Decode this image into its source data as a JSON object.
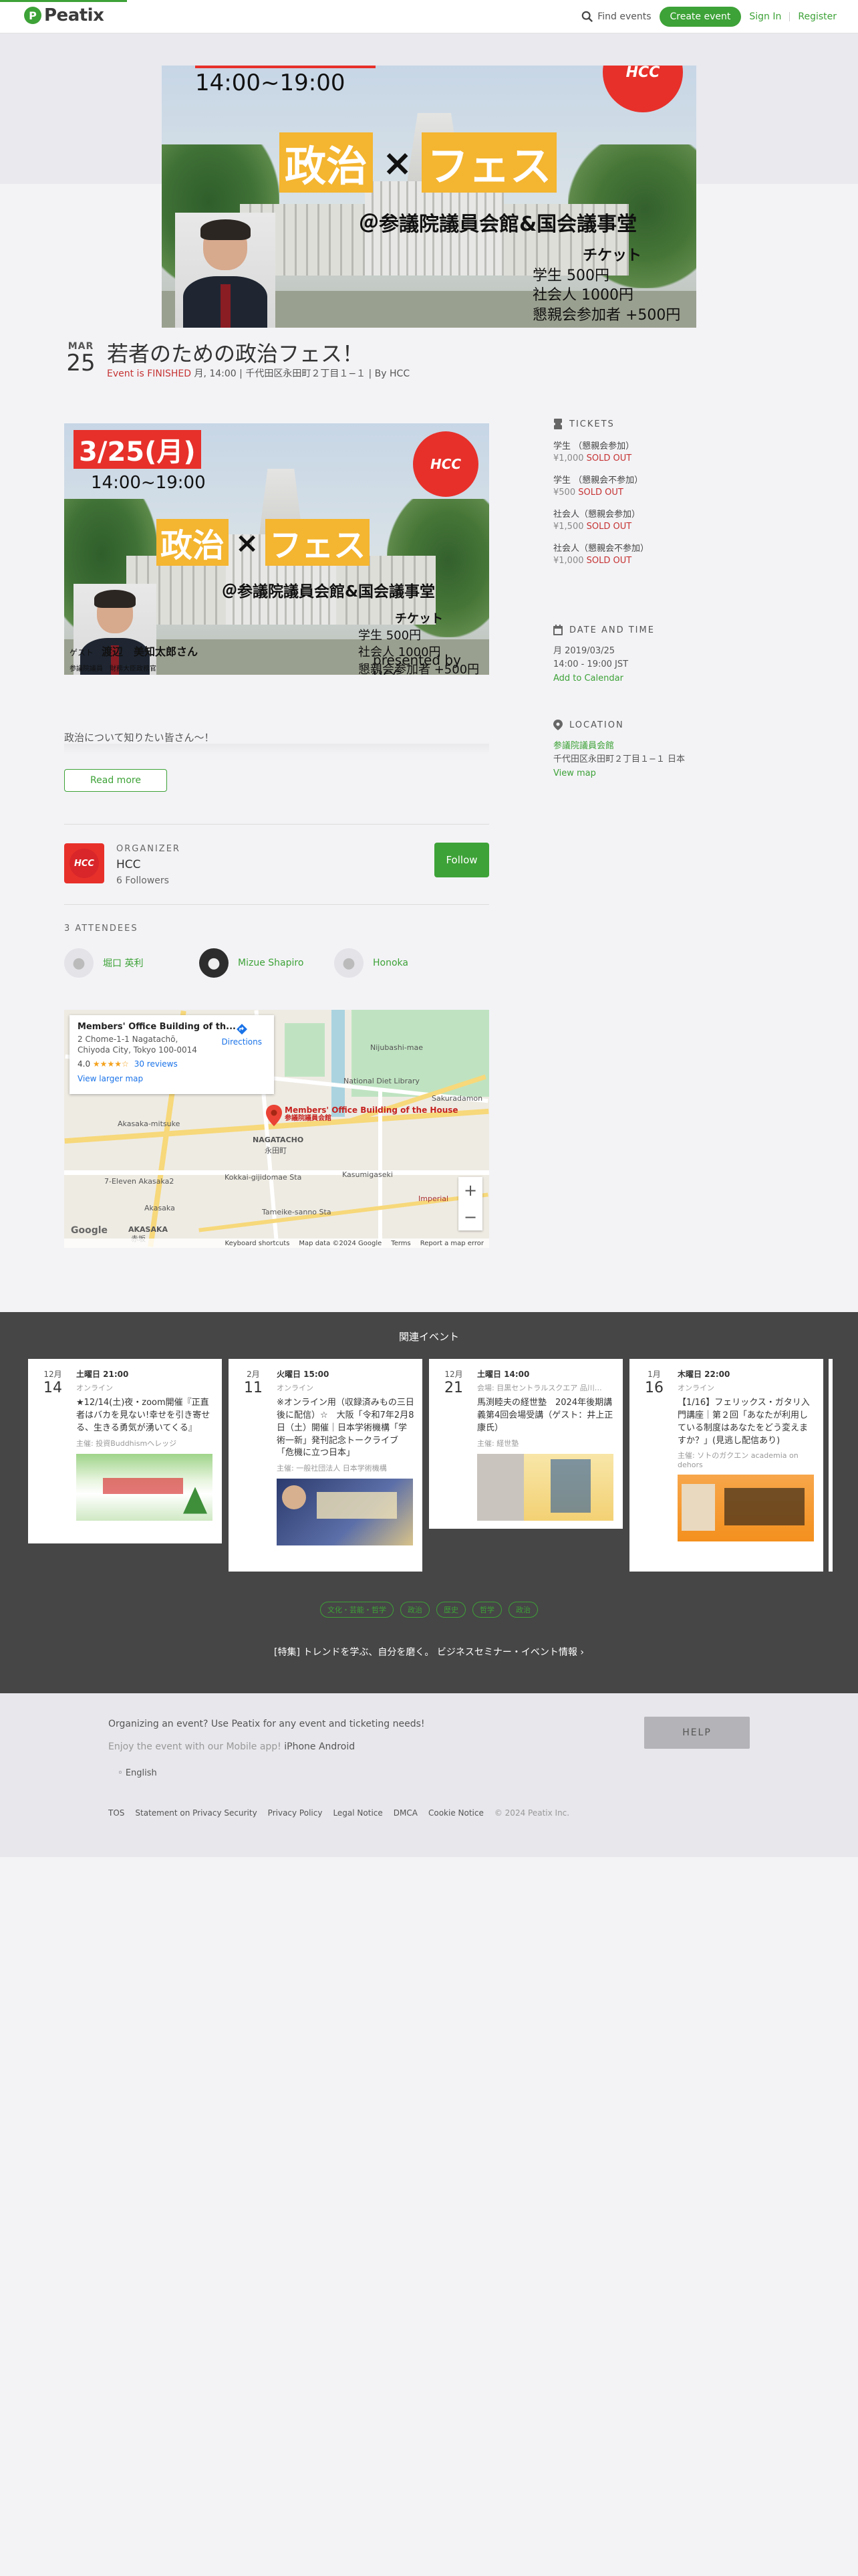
{
  "header": {
    "logo_text": "Peatix",
    "find_events": "Find events",
    "create_event": "Create event",
    "sign_in": "Sign In",
    "register": "Register"
  },
  "poster": {
    "date": "3/25(月)",
    "time": "14:00~19:00",
    "fes_left": "政治",
    "fes_x": "×",
    "fes_right": "フェス",
    "venue": "＠参議院議員会館&国会議事堂",
    "ticket_title": "チケット",
    "ticket_lines": [
      "学生 500円",
      "社会人 1000円",
      "懇親会参加者 +500円"
    ],
    "hcc_logo": "HCC",
    "guest_label": "ゲスト",
    "guest_name": "渡辺　美知太郎さん",
    "guest_title": "参議院議員　財務大臣政務官",
    "presented_by": "presented by HCC"
  },
  "event": {
    "month": "MAR",
    "day": "25",
    "title": "若者のための政治フェス！",
    "status": "Event is FINISHED",
    "meta": "月, 14:00 | 千代田区永田町２丁目１−１ | By HCC",
    "description": "政治について知りたい皆さん～！",
    "read_more": "Read more"
  },
  "organizer": {
    "label": "ORGANIZER",
    "name": "HCC",
    "followers": "6 Followers",
    "follow_button": "Follow",
    "avatar_text": "HCC"
  },
  "attendees": {
    "label": "3 ATTENDEES",
    "list": [
      {
        "name": "堀口 英利"
      },
      {
        "name": "Mizue Shapiro"
      },
      {
        "name": "Honoka"
      }
    ]
  },
  "map": {
    "place_name": "Members' Office Building of th...",
    "address": "2 Chome-1-1 Nagatachō, Chiyoda City, Tokyo 100-0014",
    "rating": "4.0",
    "stars": "★★★★☆",
    "reviews": "30 reviews",
    "directions": "Directions",
    "larger_map": "View larger map",
    "pin_label_en": "Members' Office Building of the House",
    "pin_label_jp": "参議院議員会館",
    "labels": [
      "National Diet Library",
      "Nijubashi-mae",
      "Sakuradamon",
      "Akasaka-mitsuke",
      "NAGATACHO",
      "永田町",
      "Kokkai-gijidomae Sta",
      "Kasumigaseki",
      "Tameike-sanno Sta",
      "7-Eleven Akasaka2",
      "Akasaka",
      "AKASAKA",
      "赤坂",
      "Imperial"
    ],
    "keyboard": "Keyboard shortcuts",
    "map_data": "Map data ©2024 Google",
    "terms": "Terms",
    "report": "Report a map error",
    "google": "Google"
  },
  "sidebar": {
    "tickets_label": "TICKETS",
    "tickets": [
      {
        "name": "学生 （懇親会参加）",
        "price": "¥1,000",
        "status": "SOLD OUT"
      },
      {
        "name": "学生 （懇親会不参加）",
        "price": "¥500",
        "status": "SOLD OUT"
      },
      {
        "name": "社会人（懇親会参加）",
        "price": "¥1,500",
        "status": "SOLD OUT"
      },
      {
        "name": "社会人（懇親会不参加）",
        "price": "¥1,000",
        "status": "SOLD OUT"
      }
    ],
    "datetime_label": "DATE AND TIME",
    "date_line": "月 2019/03/25",
    "time_line": "14:00 - 19:00 JST",
    "add_calendar": "Add to Calendar",
    "location_label": "LOCATION",
    "location_name": "参議院議員会館",
    "location_addr": "千代田区永田町２丁目１−１ 日本",
    "view_map": "View map"
  },
  "related": {
    "title": "関連イベント",
    "cards": [
      {
        "month": "12月",
        "day": "14",
        "time": "土曜日 21:00",
        "venue": "オンライン",
        "name": "★12/14(土)夜・zoom開催『正直者はバカを見ない!幸せを引き寄せる、生きる勇気が湧いてくる』",
        "org": "主催: 投資Buddhismヘレッジ"
      },
      {
        "month": "2月",
        "day": "11",
        "time": "火曜日 15:00",
        "venue": "オンライン",
        "name": "※オンライン用（収録済みもの三日後に配信）☆　大阪「令和7年2月8日（土）開催｜日本学術機構「学術一新」発刊記念トークライブ「危機に立つ日本」",
        "org": "主催: 一般社団法人 日本学術機構"
      },
      {
        "month": "12月",
        "day": "21",
        "time": "土曜日 14:00",
        "venue": "会場: 目黒セントラルスクエア 品川…",
        "name": "馬渕睦夫の経世塾　2024年後期講義第4回会場受講（ゲスト：井上正康氏）",
        "org": "主催: 経世塾"
      },
      {
        "month": "1月",
        "day": "16",
        "time": "木曜日 22:00",
        "venue": "オンライン",
        "name": "【1/16】フェリックス・ガタリ入門講座｜第２回「あなたが利用している制度はあなたをどう変えますか？」(見逃し配信あり)",
        "org": "主催: ソトのガクエン academia on dehors"
      }
    ],
    "tags": [
      "文化・芸能・哲学",
      "政治",
      "歴史",
      "哲学",
      "政治"
    ],
    "feature": "[特集] トレンドを学ぶ、自分を磨く。 ビジネスセミナー・イベント情報"
  },
  "footer": {
    "organizing": "Organizing an event? Use Peatix for any event and ticketing needs!",
    "mobile_prefix": "Enjoy the event with our Mobile app!",
    "iphone": "iPhone",
    "android": "Android",
    "help": "HELP",
    "language": "English",
    "links": [
      "TOS",
      "Statement on Privacy Security",
      "Privacy Policy",
      "Legal Notice",
      "DMCA",
      "Cookie Notice"
    ],
    "copyright": "© 2024 Peatix Inc."
  }
}
